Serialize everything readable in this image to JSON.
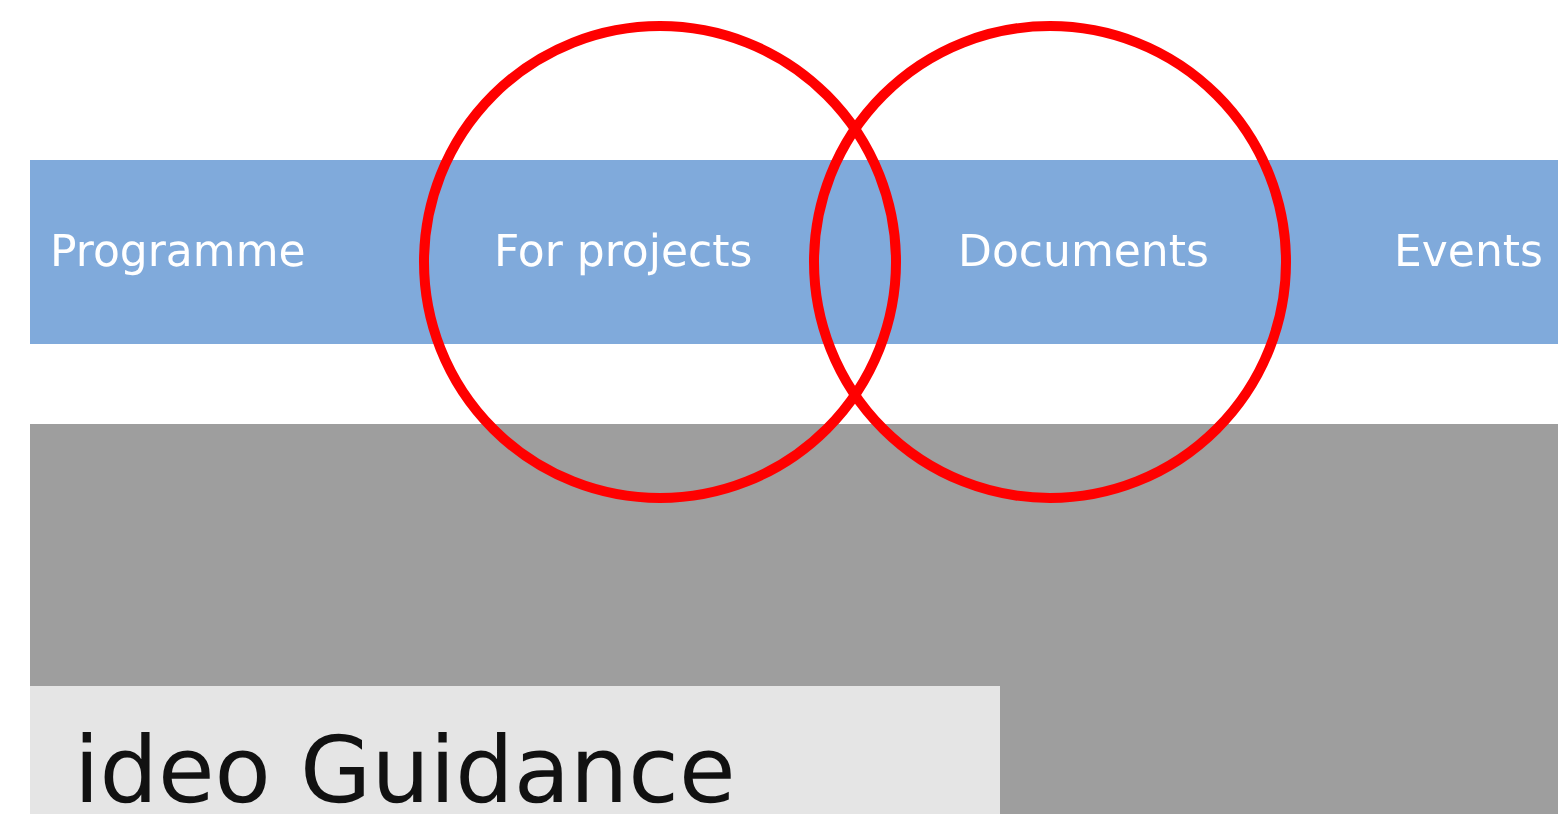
{
  "nav": {
    "items": [
      {
        "label": "Programme"
      },
      {
        "label": "For projects"
      },
      {
        "label": "Documents"
      },
      {
        "label": "Events"
      }
    ]
  },
  "banner": {
    "title": "ideo Guidance"
  },
  "annotations": [
    {
      "kind": "circle"
    },
    {
      "kind": "circle"
    }
  ]
}
